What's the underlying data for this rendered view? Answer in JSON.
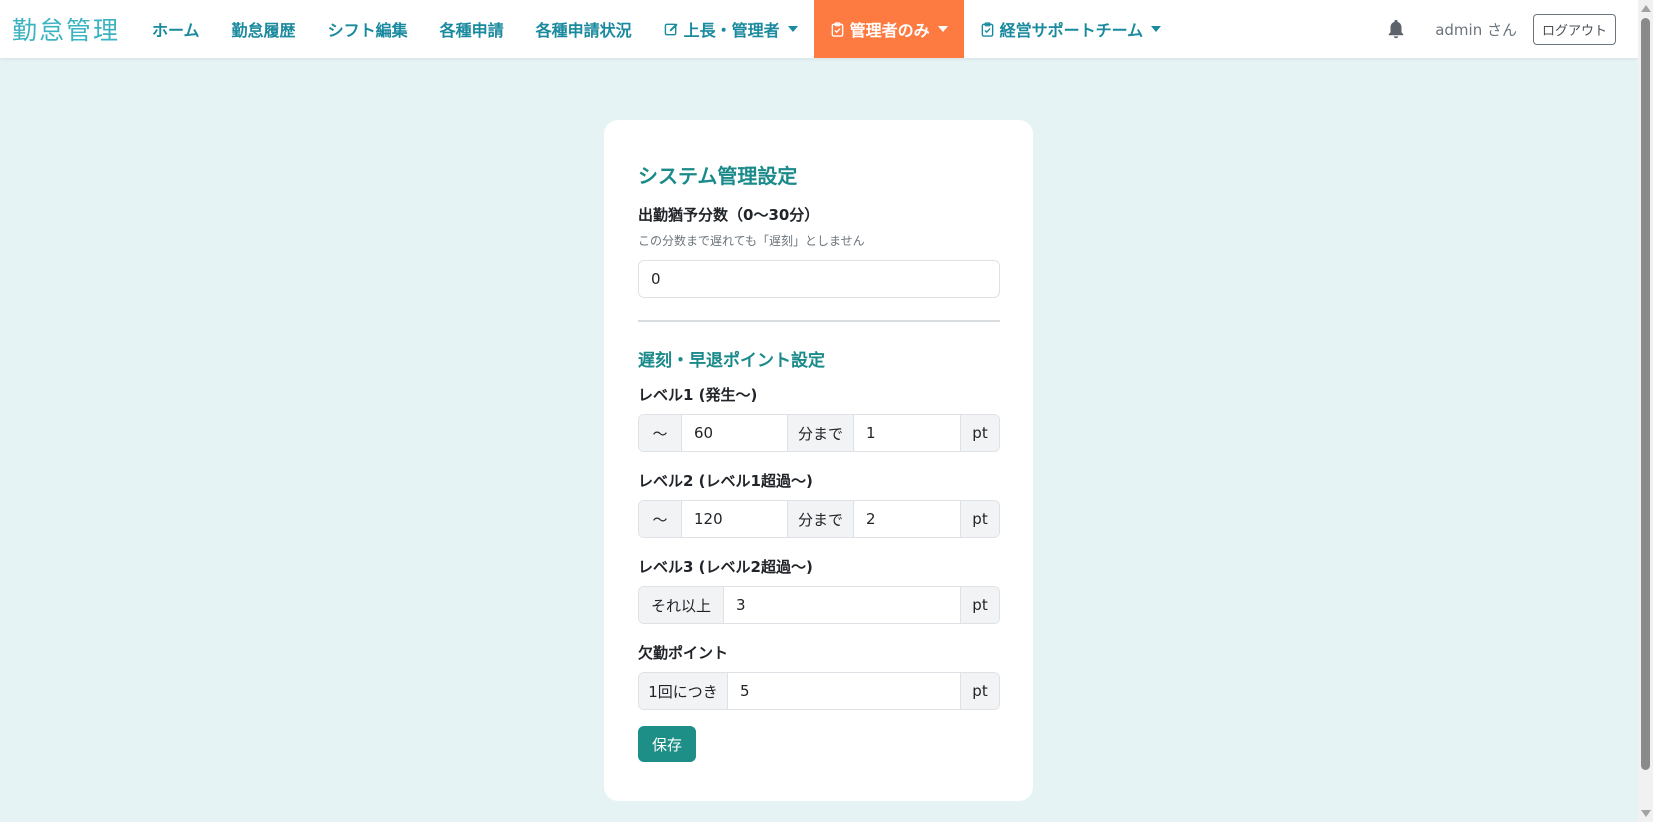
{
  "navbar": {
    "brand": "勤怠管理",
    "items": [
      {
        "label": "ホーム"
      },
      {
        "label": "勤怠履歴"
      },
      {
        "label": "シフト編集"
      },
      {
        "label": "各種申請"
      },
      {
        "label": "各種申請状況"
      },
      {
        "label": "上長・管理者",
        "icon": "edit-icon",
        "dropdown": true
      },
      {
        "label": "管理者のみ",
        "icon": "clipboard-check-icon",
        "dropdown": true,
        "active": true
      },
      {
        "label": "経営サポートチーム",
        "icon": "clipboard-check-icon",
        "dropdown": true
      }
    ],
    "user": "admin さん",
    "logout": "ログアウト",
    "bell_icon": "bell-icon"
  },
  "colors": {
    "brand": "#3bb3c0",
    "nav_text": "#1a8a9e",
    "active_tab": "#fd7a41",
    "accent": "#1a8a8a",
    "save_button": "#1e8f86",
    "background": "#e6f3f5"
  },
  "settings": {
    "title": "システム管理設定",
    "grace": {
      "label": "出勤猶予分数（0〜30分）",
      "help": "この分数まで遅れても「遅刻」としません",
      "value": "0"
    },
    "points": {
      "title": "遅刻・早退ポイント設定",
      "level1": {
        "label": "レベル1 (発生〜)",
        "prefix": "〜",
        "minutes": "60",
        "mid": "分まで",
        "points": "1",
        "unit": "pt"
      },
      "level2": {
        "label": "レベル2 (レベル1超過〜)",
        "prefix": "〜",
        "minutes": "120",
        "mid": "分まで",
        "points": "2",
        "unit": "pt"
      },
      "level3": {
        "label": "レベル3 (レベル2超過〜)",
        "prefix": "それ以上",
        "points": "3",
        "unit": "pt"
      },
      "absence": {
        "label": "欠勤ポイント",
        "prefix": "1回につき",
        "points": "5",
        "unit": "pt"
      }
    },
    "save": "保存"
  }
}
